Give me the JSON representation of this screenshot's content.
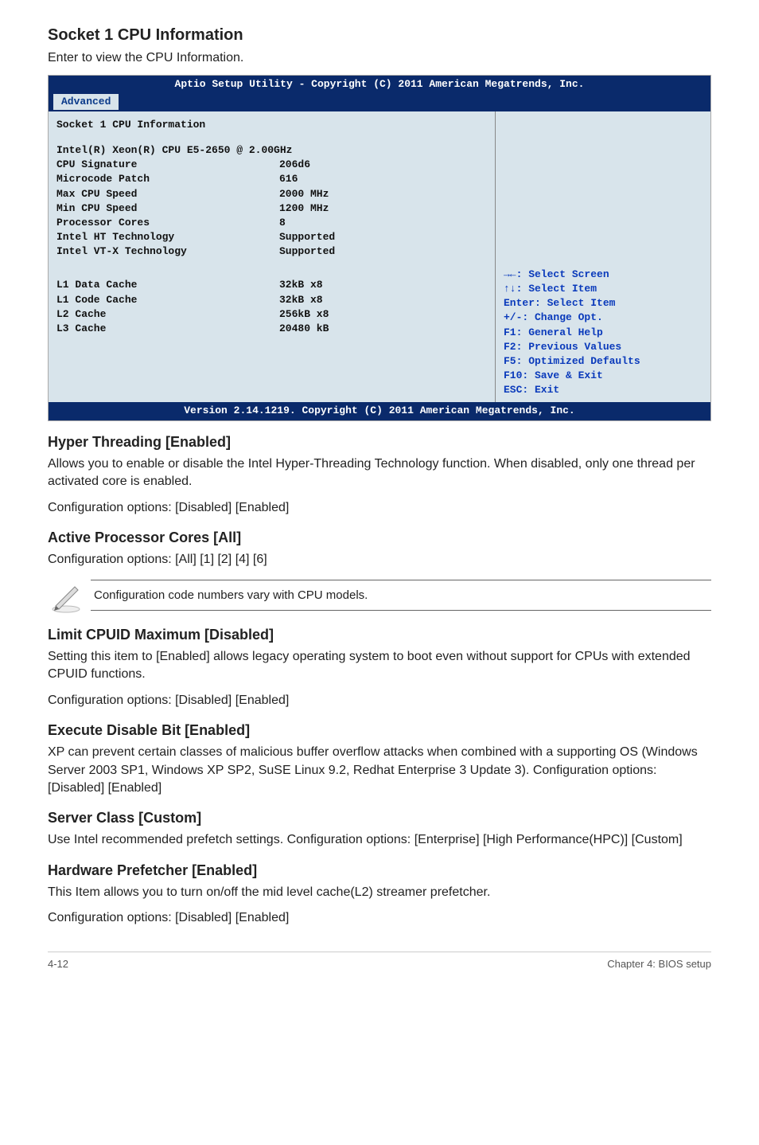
{
  "sections": {
    "socket_info": {
      "heading": "Socket 1 CPU Information",
      "intro": "Enter to view the CPU Information."
    },
    "hyper_threading": {
      "heading": "Hyper Threading [Enabled]",
      "body1": "Allows you to enable or disable the Intel Hyper-Threading Technology function. When disabled, only one thread per activated core is enabled.",
      "body2": "Configuration options: [Disabled] [Enabled]"
    },
    "active_cores": {
      "heading": "Active Processor Cores [All]",
      "body1": "Configuration options: [All] [1] [2] [4] [6]"
    },
    "note": {
      "text": "Configuration code numbers vary with CPU models."
    },
    "limit_cpuid": {
      "heading": "Limit CPUID Maximum [Disabled]",
      "body1": "Setting this item to [Enabled] allows legacy operating system to boot even without support for CPUs with extended CPUID functions.",
      "body2": "Configuration options: [Disabled] [Enabled]"
    },
    "exec_disable": {
      "heading": "Execute Disable Bit [Enabled]",
      "body1": "XP can prevent certain classes of malicious buffer overflow attacks when combined with a supporting OS (Windows Server 2003 SP1, Windows XP SP2, SuSE Linux 9.2, Redhat Enterprise 3 Update 3). Configuration options: [Disabled] [Enabled]"
    },
    "server_class": {
      "heading": "Server Class [Custom]",
      "body1": "Use Intel recommended prefetch settings. Configuration options: [Enterprise] [High Performance(HPC)] [Custom]"
    },
    "hw_prefetch": {
      "heading": "Hardware Prefetcher [Enabled]",
      "body1": "This Item allows you to turn on/off the mid level cache(L2) streamer prefetcher.",
      "body2": "Configuration options: [Disabled] [Enabled]"
    }
  },
  "bios": {
    "header": "Aptio Setup Utility - Copyright (C) 2011 American Megatrends, Inc.",
    "tab": "Advanced",
    "group_title": "Socket 1 CPU Information",
    "cpu_line": "Intel(R) Xeon(R) CPU E5-2650 @ 2.00GHz",
    "rows": [
      {
        "k": "CPU Signature",
        "v": "206d6"
      },
      {
        "k": "Microcode Patch",
        "v": "616"
      },
      {
        "k": "Max CPU Speed",
        "v": "2000 MHz"
      },
      {
        "k": "Min CPU Speed",
        "v": "1200 MHz"
      },
      {
        "k": "Processor Cores",
        "v": "8"
      },
      {
        "k": "Intel HT Technology",
        "v": "Supported"
      },
      {
        "k": "Intel VT-X Technology",
        "v": "Supported"
      }
    ],
    "cache_rows": [
      {
        "k": "L1 Data Cache",
        "v": "32kB x8"
      },
      {
        "k": "L1 Code Cache",
        "v": "32kB x8"
      },
      {
        "k": "L2 Cache",
        "v": "256kB x8"
      },
      {
        "k": "L3 Cache",
        "v": "20480 kB"
      }
    ],
    "help": [
      "→←: Select Screen",
      "↑↓:  Select Item",
      "Enter: Select Item",
      "+/-: Change Opt.",
      "F1: General Help",
      "F2: Previous Values",
      "F5: Optimized Defaults",
      "F10: Save & Exit",
      "ESC: Exit"
    ],
    "footer": "Version 2.14.1219. Copyright (C) 2011 American Megatrends, Inc."
  },
  "footer": {
    "page": "4-12",
    "chapter": "Chapter 4: BIOS setup"
  }
}
